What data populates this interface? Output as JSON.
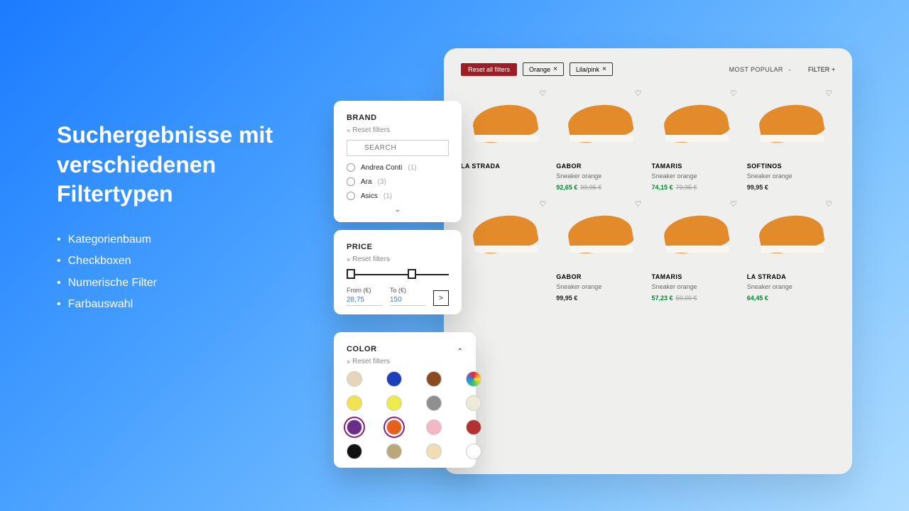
{
  "hero": {
    "title": "Suchergebnisse mit verschiedenen Filtertypen",
    "bullets": [
      "Kategorienbaum",
      "Checkboxen",
      "Numerische Filter",
      "Farbauswahl"
    ]
  },
  "results": {
    "reset_label": "Reset all filters",
    "chips": [
      {
        "label": "Orange"
      },
      {
        "label": "Lila/pink"
      }
    ],
    "sort_label": "MOST POPULAR",
    "filter_label": "FILTER",
    "products": [
      {
        "brand": "LA STRADA",
        "name": "",
        "price": "",
        "old": ""
      },
      {
        "brand": "GABOR",
        "name": "Sneaker orange",
        "price": "92,65 €",
        "old": "99,95 €"
      },
      {
        "brand": "TAMARIS",
        "name": "Sneaker orange",
        "price": "74,15 €",
        "old": "79,95 €"
      },
      {
        "brand": "SOFTINOS",
        "name": "Sneaker orange",
        "price": "99,95 €",
        "old": ""
      },
      {
        "brand": "",
        "name": "",
        "price": "",
        "old": ""
      },
      {
        "brand": "GABOR",
        "name": "Sneaker orange",
        "price": "99,95 €",
        "old": "",
        "black": true
      },
      {
        "brand": "TAMARIS",
        "name": "Sneaker orange",
        "price": "57,23 €",
        "old": "59,00 €"
      },
      {
        "brand": "LA STRADA",
        "name": "Sneaker orange",
        "price": "64,45 €",
        "old": ""
      }
    ]
  },
  "brand_card": {
    "title": "BRAND",
    "reset": "Reset filters",
    "search_placeholder": "SEARCH",
    "options": [
      {
        "label": "Andrea Conti",
        "count": "(1)"
      },
      {
        "label": "Ara",
        "count": "(3)"
      },
      {
        "label": "Asics",
        "count": "(1)"
      }
    ]
  },
  "price_card": {
    "title": "PRICE",
    "reset": "Reset filters",
    "from_label": "From (€)",
    "to_label": "To (€)",
    "from_value": "28,75",
    "to_value": "150"
  },
  "color_card": {
    "title": "COLOR",
    "reset": "Reset filters",
    "swatches": [
      "#e7d5bb",
      "#1d3fbe",
      "#8a4b1e",
      "multi",
      "#f2e24d",
      "#eced4a",
      "#8f8f8f",
      "#efe9d8",
      "#6b2d88",
      "#e4611a",
      "#f4b7c6",
      "#b23131",
      "#111111",
      "#bca77a",
      "#f0dcb5",
      "#ffffff"
    ],
    "selected": [
      8,
      9
    ]
  }
}
